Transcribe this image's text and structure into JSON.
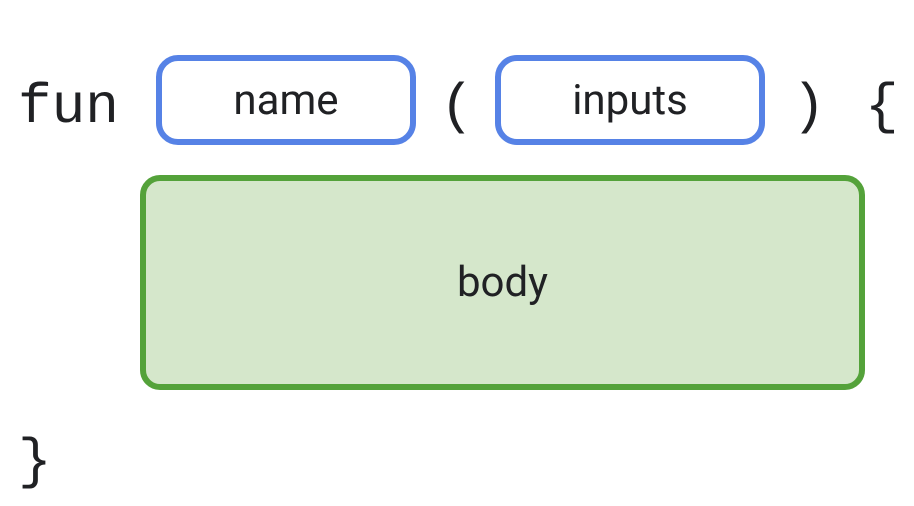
{
  "syntax": {
    "keyword_fun": "fun",
    "lparen": "(",
    "rparen": ")",
    "lbrace": "{",
    "rbrace": "}"
  },
  "slots": {
    "name": "name",
    "inputs": "inputs",
    "body": "body"
  },
  "colors": {
    "blue_border": "#5682e6",
    "green_border": "#54a23a",
    "green_fill": "#d5e7cb"
  }
}
